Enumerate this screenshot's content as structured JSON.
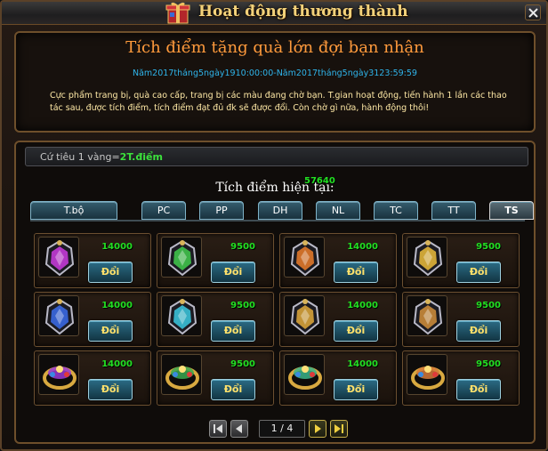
{
  "header": {
    "title": "Hoạt động thương thành",
    "icon": "gift-box-icon",
    "close_icon": "close-icon"
  },
  "event": {
    "title": "Tích điểm tặng quà lớn đợi bạn nhận",
    "time": "Năm2017tháng5ngày1910:00:00-Năm2017tháng5ngày3123:59:59",
    "description": "Cực phẩm trang bị, quà cao cấp, trang bị các màu đang chờ bạn. T.gian hoạt động, tiến hành 1 lần các thao tác sau, được tích điểm, tích điểm đạt đủ đk sẽ được đổi. Còn chờ gì nữa, hành động thôi!"
  },
  "rate": {
    "prefix": "Cứ tiêu 1 vàng=",
    "value": "2T.điểm"
  },
  "points": {
    "label": "Tích điểm hiện tại:",
    "value": "57640"
  },
  "tabs": [
    {
      "label": "T.bộ",
      "active": false
    },
    {
      "label": "PC",
      "active": false
    },
    {
      "label": "PP",
      "active": false
    },
    {
      "label": "DH",
      "active": false
    },
    {
      "label": "NL",
      "active": false
    },
    {
      "label": "TC",
      "active": false
    },
    {
      "label": "TT",
      "active": false
    },
    {
      "label": "TS",
      "active": true
    }
  ],
  "items": [
    {
      "icon": "pink-amulet-icon",
      "price": "14000",
      "button": "Đổi",
      "color": "#c23ad6"
    },
    {
      "icon": "green-amulet-icon",
      "price": "9500",
      "button": "Đổi",
      "color": "#3fc24a"
    },
    {
      "icon": "orange-amulet-icon",
      "price": "14000",
      "button": "Đổi",
      "color": "#e0782a"
    },
    {
      "icon": "gold-amulet-icon",
      "price": "9500",
      "button": "Đổi",
      "color": "#e0b43a"
    },
    {
      "icon": "blue-amulet-icon",
      "price": "14000",
      "button": "Đổi",
      "color": "#3a68e0"
    },
    {
      "icon": "cyan-amulet-icon",
      "price": "9500",
      "button": "Đổi",
      "color": "#3ac0d6"
    },
    {
      "icon": "gem-bracelet-icon",
      "price": "14000",
      "button": "Đổi",
      "color": "#d6a23a"
    },
    {
      "icon": "gem-ring-icon",
      "price": "9500",
      "button": "Đổi",
      "color": "#c98a3a"
    },
    {
      "icon": "purple-bracelet-icon",
      "price": "14000",
      "button": "Đổi",
      "color": "#9a3ad6"
    },
    {
      "icon": "green-bracelet-icon",
      "price": "9500",
      "button": "Đổi",
      "color": "#3aa850"
    },
    {
      "icon": "jade-bracelet-icon",
      "price": "14000",
      "button": "Đổi",
      "color": "#3ab48a"
    },
    {
      "icon": "jeweled-ring-icon",
      "price": "9500",
      "button": "Đổi",
      "color": "#d67a3a"
    }
  ],
  "pager": {
    "page": "1 / 4",
    "first_icon": "first-page-icon",
    "prev_icon": "prev-page-icon",
    "next_icon": "next-page-icon",
    "last_icon": "last-page-icon"
  }
}
